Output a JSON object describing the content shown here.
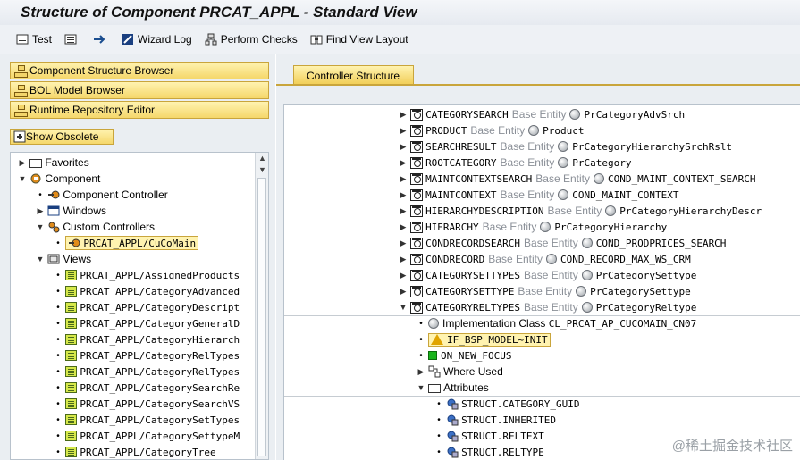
{
  "title": "Structure of Component PRCAT_APPL - Standard View",
  "toolbar": {
    "test": "Test",
    "wizard_log": "Wizard Log",
    "perform_checks": "Perform Checks",
    "find_view_layout": "Find View Layout"
  },
  "left": {
    "component_structure_browser": "Component Structure Browser",
    "bol_model_browser": "BOL Model Browser",
    "runtime_repository_editor": "Runtime Repository Editor",
    "show_obsolete": "Show Obsolete",
    "tree": {
      "favorites": "Favorites",
      "component": "Component",
      "component_controller": "Component Controller",
      "windows": "Windows",
      "custom_controllers": "Custom Controllers",
      "cucomain": "PRCAT_APPL/CuCoMain",
      "views": "Views",
      "view_items": [
        "PRCAT_APPL/AssignedProducts",
        "PRCAT_APPL/CategoryAdvanced",
        "PRCAT_APPL/CategoryDescript",
        "PRCAT_APPL/CategoryGeneralD",
        "PRCAT_APPL/CategoryHierarch",
        "PRCAT_APPL/CategoryRelTypes",
        "PRCAT_APPL/CategoryRelTypes",
        "PRCAT_APPL/CategorySearchRe",
        "PRCAT_APPL/CategorySearchVS",
        "PRCAT_APPL/CategorySetTypes",
        "PRCAT_APPL/CategorySettypeM",
        "PRCAT_APPL/CategoryTree"
      ]
    }
  },
  "right": {
    "tab_label": "Controller Structure",
    "base_entity_label": "Base Entity",
    "contexts": [
      {
        "name": "CATEGORYSEARCH",
        "entity": "PrCategoryAdvSrch"
      },
      {
        "name": "PRODUCT",
        "entity": "Product"
      },
      {
        "name": "SEARCHRESULT",
        "entity": "PrCategoryHierarchySrchRslt"
      },
      {
        "name": "ROOTCATEGORY",
        "entity": "PrCategory"
      },
      {
        "name": "MAINTCONTEXTSEARCH",
        "entity": "COND_MAINT_CONTEXT_SEARCH"
      },
      {
        "name": "MAINTCONTEXT",
        "entity": "COND_MAINT_CONTEXT"
      },
      {
        "name": "HIERARCHYDESCRIPTION",
        "entity": "PrCategoryHierarchyDescr"
      },
      {
        "name": "HIERARCHY",
        "entity": "PrCategoryHierarchy"
      },
      {
        "name": "CONDRECORDSEARCH",
        "entity": "COND_PRODPRICES_SEARCH"
      },
      {
        "name": "CONDRECORD",
        "entity": "COND_RECORD_MAX_WS_CRM"
      },
      {
        "name": "CATEGORYSETTYPES",
        "entity": "PrCategorySettype"
      },
      {
        "name": "CATEGORYSETTYPE",
        "entity": "PrCategorySettype"
      },
      {
        "name": "CATEGORYRELTYPES",
        "entity": "PrCategoryReltype"
      }
    ],
    "impl_class_label": "Implementation Class",
    "impl_class": "CL_PRCAT_AP_CUCOMAIN_CN07",
    "model_init": "IF_BSP_MODEL~INIT",
    "on_new_focus": "ON_NEW_FOCUS",
    "where_used": "Where Used",
    "attributes": "Attributes",
    "attribute_items": [
      "STRUCT.CATEGORY_GUID",
      "STRUCT.INHERITED",
      "STRUCT.RELTEXT",
      "STRUCT.RELTYPE"
    ]
  },
  "watermark": "@稀土掘金技术社区"
}
